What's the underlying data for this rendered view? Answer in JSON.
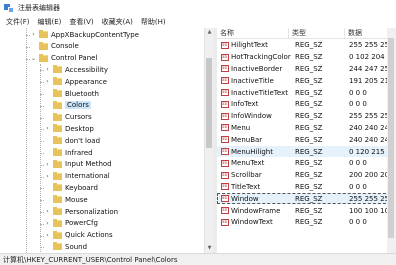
{
  "window": {
    "title": "注册表编辑器"
  },
  "menu": [
    "文件(F)",
    "编辑(E)",
    "查看(V)",
    "收藏夹(A)",
    "帮助(H)"
  ],
  "tree": {
    "items": [
      {
        "label": "AppXBackupContentType",
        "level": 1,
        "expander": "›"
      },
      {
        "label": "Console",
        "level": 1,
        "expander": ""
      },
      {
        "label": "Control Panel",
        "level": 1,
        "expander": "⌄"
      },
      {
        "label": "Accessibility",
        "level": 2,
        "expander": "›"
      },
      {
        "label": "Appearance",
        "level": 2,
        "expander": "›"
      },
      {
        "label": "Bluetooth",
        "level": 2,
        "expander": ""
      },
      {
        "label": "Colors",
        "level": 2,
        "expander": "",
        "selected": true
      },
      {
        "label": "Cursors",
        "level": 2,
        "expander": ""
      },
      {
        "label": "Desktop",
        "level": 2,
        "expander": "›"
      },
      {
        "label": "don't load",
        "level": 2,
        "expander": ""
      },
      {
        "label": "Infrared",
        "level": 2,
        "expander": ""
      },
      {
        "label": "Input Method",
        "level": 2,
        "expander": "›"
      },
      {
        "label": "International",
        "level": 2,
        "expander": "›"
      },
      {
        "label": "Keyboard",
        "level": 2,
        "expander": ""
      },
      {
        "label": "Mouse",
        "level": 2,
        "expander": ""
      },
      {
        "label": "Personalization",
        "level": 2,
        "expander": "›"
      },
      {
        "label": "PowerCfg",
        "level": 2,
        "expander": "›"
      },
      {
        "label": "Quick Actions",
        "level": 2,
        "expander": "›"
      },
      {
        "label": "Sound",
        "level": 2,
        "expander": ""
      }
    ]
  },
  "values": {
    "headers": [
      "名称",
      "类型",
      "数据"
    ],
    "rows": [
      {
        "name": "HilightText",
        "type": "REG_SZ",
        "data": "255 255 255"
      },
      {
        "name": "HotTrackingColor",
        "type": "REG_SZ",
        "data": "0 102 204"
      },
      {
        "name": "InactiveBorder",
        "type": "REG_SZ",
        "data": "244 247 252"
      },
      {
        "name": "InactiveTitle",
        "type": "REG_SZ",
        "data": "191 205 219"
      },
      {
        "name": "InactiveTitleText",
        "type": "REG_SZ",
        "data": "0 0 0"
      },
      {
        "name": "InfoText",
        "type": "REG_SZ",
        "data": "0 0 0"
      },
      {
        "name": "InfoWindow",
        "type": "REG_SZ",
        "data": "255 255 255"
      },
      {
        "name": "Menu",
        "type": "REG_SZ",
        "data": "240 240 240"
      },
      {
        "name": "MenuBar",
        "type": "REG_SZ",
        "data": "240 240 240"
      },
      {
        "name": "MenuHilight",
        "type": "REG_SZ",
        "data": "0 120 215",
        "state": "hl"
      },
      {
        "name": "MenuText",
        "type": "REG_SZ",
        "data": "0 0 0"
      },
      {
        "name": "Scrollbar",
        "type": "REG_SZ",
        "data": "200 200 200"
      },
      {
        "name": "TitleText",
        "type": "REG_SZ",
        "data": "0 0 0"
      },
      {
        "name": "Window",
        "type": "REG_SZ",
        "data": "255 255 255",
        "state": "focus"
      },
      {
        "name": "WindowFrame",
        "type": "REG_SZ",
        "data": "100 100 100"
      },
      {
        "name": "WindowText",
        "type": "REG_SZ",
        "data": "0 0 0"
      }
    ]
  },
  "status": {
    "path": "计算机\\HKEY_CURRENT_USER\\Control Panel\\Colors"
  }
}
